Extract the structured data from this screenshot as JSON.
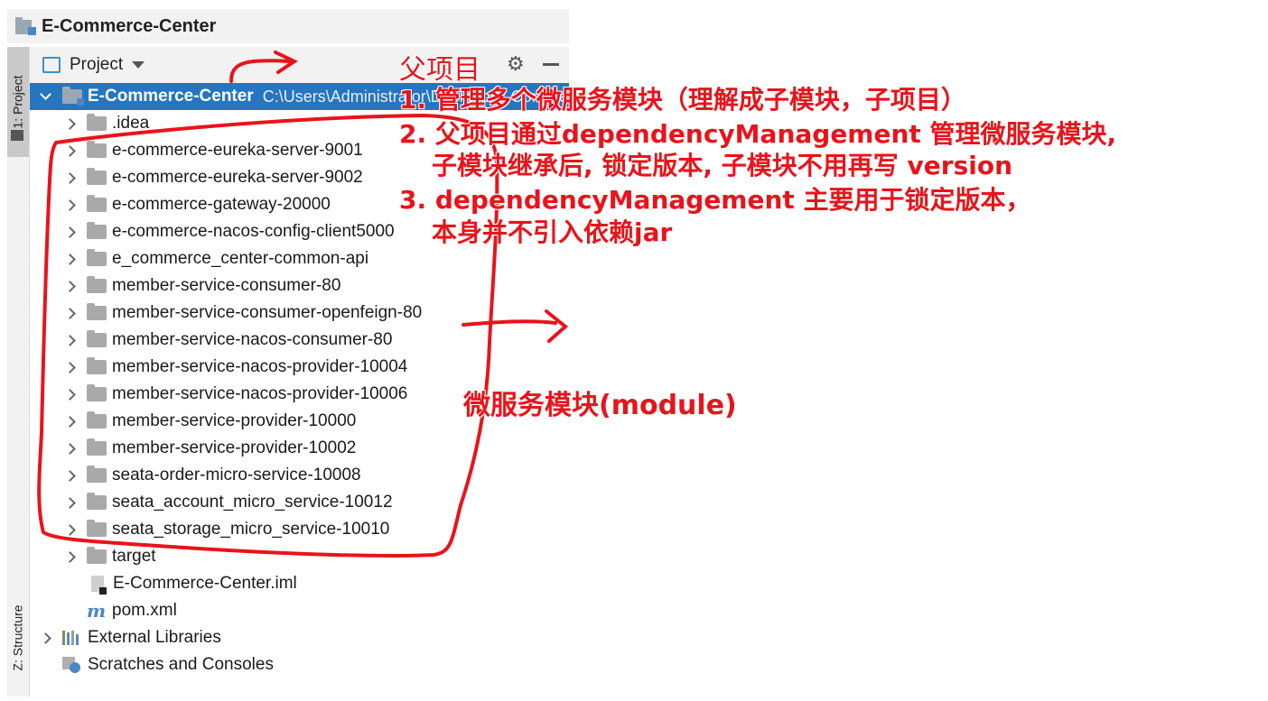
{
  "window": {
    "title": "E-Commerce-Center"
  },
  "left_strip": {
    "project_tab": "1: Project",
    "structure_tab": "Z: Structure"
  },
  "panel": {
    "view_label": "Project"
  },
  "tree": {
    "root": {
      "label": "E-Commerce-Center",
      "path": "C:\\Users\\Administrator\\Desktop\\E-Commerce-Center"
    },
    "folders": [
      ".idea",
      "e-commerce-eureka-server-9001",
      "e-commerce-eureka-server-9002",
      "e-commerce-gateway-20000",
      "e-commerce-nacos-config-client5000",
      "e_commerce_center-common-api",
      "member-service-consumer-80",
      "member-service-consumer-openfeign-80",
      "member-service-nacos-consumer-80",
      "member-service-nacos-provider-10004",
      "member-service-nacos-provider-10006",
      "member-service-provider-10000",
      "member-service-provider-10002",
      "seata-order-micro-service-10008",
      "seata_account_micro_service-10012",
      "seata_storage_micro_service-10010",
      "target"
    ],
    "files": [
      "E-Commerce-Center.iml",
      "pom.xml"
    ],
    "external_libraries": "External Libraries",
    "scratches": "Scratches and Consoles"
  },
  "annotations": {
    "parent_title": "父项目",
    "line1": "1. 管理多个微服务模块（理解成子模块，子项目）",
    "line2a": "2. 父项目通过dependencyManagement 管理微服务模块,",
    "line2b": "子模块继承后, 锁定版本, 子模块不用再写 version",
    "line3a": "3. dependencyManagement 主要用于锁定版本，",
    "line3b": "本身并不引入依赖jar",
    "modules_label": "微服务模块(module)"
  },
  "colors": {
    "selection": "#2675bf",
    "annotation": "#e8141b",
    "panel_bg": "#f2f2f2"
  }
}
